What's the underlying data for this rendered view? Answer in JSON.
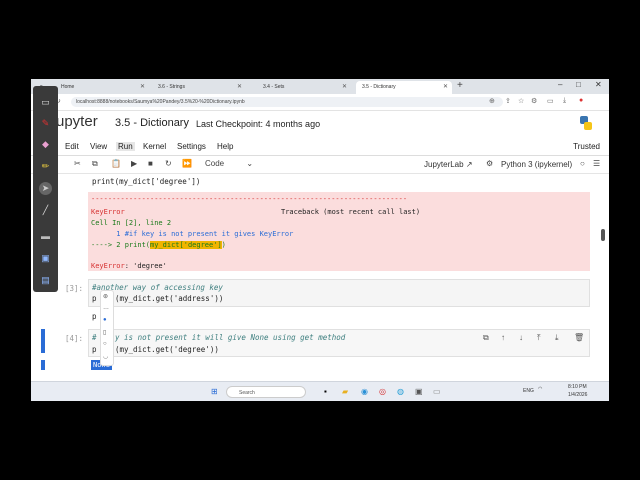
{
  "browser": {
    "tabs": [
      {
        "label": "Home"
      },
      {
        "label": "3.6 - Strings"
      },
      {
        "label": "3.4 - Sets"
      },
      {
        "label": "3.5 - Dictionary"
      }
    ],
    "new_tab": "+",
    "url": "localhost:8888/notebooks/Saumya%20Pandey/3.5%20-%20Dictionary.ipynb"
  },
  "jupyter": {
    "logo_text": "upyter",
    "notebook_title": "3.5 - Dictionary",
    "checkpoint": "Last Checkpoint: 4 months ago",
    "menus": [
      "Edit",
      "View",
      "Run",
      "Kernel",
      "Settings",
      "Help"
    ],
    "trusted": "Trusted",
    "toolbar": {
      "cell_type": "Code",
      "kernel_link": "JupyterLab",
      "kernel_name": "Python 3 (ipykernel)"
    }
  },
  "cells": {
    "top_line": "print(my_dict['degree'])",
    "error": {
      "dashes": "---------------------------------------------------------------------------",
      "name": "KeyError",
      "traceback": "Traceback (most recent call last)",
      "line1": "Cell In [2], line 2",
      "line2": "      1 #if key is not present it gives KeyError",
      "line3_prefix": "----> 2 print(",
      "line3_hl": "my_dict['degree']",
      "line3_suffix": ")",
      "final_name": "KeyError",
      "final_msg": ": 'degree'"
    },
    "cell3": {
      "prompt": "[3]:",
      "comment": "#another way of accessing key",
      "code_prefix": "p",
      "code": "(my_dict.get('address'))",
      "out_frag": "p"
    },
    "cell4": {
      "prompt": "[4]:",
      "comment_prefix": "#",
      "comment": "y is not present it will give None using get method",
      "code_prefix": "p",
      "code": "(my_dict.get('degree'))",
      "output": "None"
    }
  },
  "taskbar": {
    "search_placeholder": "Search",
    "lang": "ENG",
    "time": "8:10 PM",
    "date": "1/4/2026"
  },
  "colors": {
    "accent": "#2a6cd6",
    "error_bg": "#fbdddd",
    "error_red": "#d63030",
    "highlight": "#f0b400"
  }
}
